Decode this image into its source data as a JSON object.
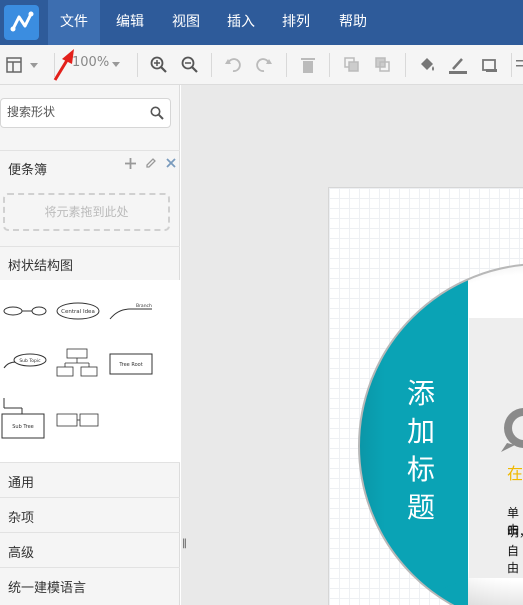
{
  "menubar": {
    "items": [
      {
        "label": "文件",
        "active": true
      },
      {
        "label": "编辑",
        "active": false
      },
      {
        "label": "视图",
        "active": false
      },
      {
        "label": "插入",
        "active": false
      },
      {
        "label": "排列",
        "active": false
      },
      {
        "label": "帮助",
        "active": false
      }
    ]
  },
  "toolbar": {
    "zoom": "100%",
    "icons": [
      "page-view-icon",
      "zoom-in-icon",
      "zoom-out-icon",
      "undo-icon",
      "redo-icon",
      "delete-icon",
      "to-front-icon",
      "to-back-icon",
      "fill-color-icon",
      "line-color-icon",
      "shadow-icon"
    ]
  },
  "sidebar": {
    "search": {
      "placeholder": "搜索形状"
    },
    "notebook": {
      "label": "便条簿",
      "drop_hint": "将元素拖到此处"
    },
    "tree_section": {
      "label": "树状结构图"
    },
    "shapes": {
      "central_idea": "Central Idea",
      "branch": "Branch",
      "sub_topic": "Sub Topic",
      "tree_root": "Tree Root",
      "sub_tree": "Sub Tree"
    },
    "categories": [
      "通用",
      "杂项",
      "高级",
      "统一建模语言"
    ]
  },
  "canvas": {
    "title_chars": [
      "添",
      "加",
      "标",
      "题"
    ],
    "yellow_text": "在",
    "body_lines": [
      "单击",
      "明，",
      "自由"
    ]
  },
  "colors": {
    "menubar": "#2e5b9a",
    "active_menu": "#3d6eb0",
    "teal": "#0aa3b5",
    "accent_yellow": "#f0b800"
  }
}
